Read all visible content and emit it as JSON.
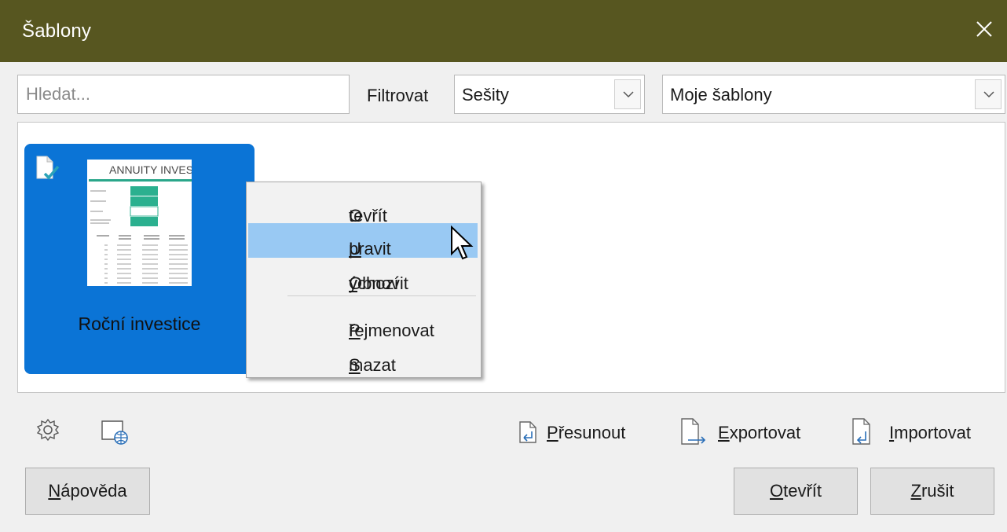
{
  "dialog": {
    "title": "Šablony"
  },
  "search": {
    "placeholder": "Hledat..."
  },
  "filter": {
    "label": "Filtrovat",
    "type_value": "Sešity",
    "region_value": "Moje šablony"
  },
  "template": {
    "name": "Roční investice",
    "thumbnail_title": "ANNUITY INVES"
  },
  "context_menu": {
    "items": [
      {
        "first": "O",
        "rest": "tevřít"
      },
      {
        "first": "U",
        "rest": "pravit"
      },
      {
        "pre": "Obnovit ",
        "u": "v",
        "rest": "ýchozí"
      },
      {
        "first": "P",
        "rest": "řejmenovat"
      },
      {
        "first": "S",
        "rest": "mazat"
      }
    ]
  },
  "actions": {
    "move": {
      "first": "P",
      "rest": "řesunout"
    },
    "export": {
      "first": "E",
      "rest": "xportovat"
    },
    "import": {
      "first": "I",
      "rest": "mportovat"
    }
  },
  "buttons": {
    "help": {
      "first": "N",
      "rest": "ápověda"
    },
    "open": {
      "first": "O",
      "rest": "tevřít"
    },
    "cancel": {
      "first": "Z",
      "rest": "rušit"
    }
  },
  "colors": {
    "titlebar": "#575620",
    "selection": "#0b74d6",
    "menu_highlight": "#99c9f3"
  }
}
